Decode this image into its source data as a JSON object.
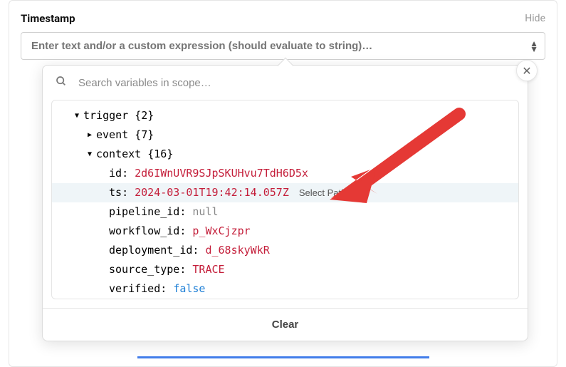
{
  "field": {
    "label": "Timestamp",
    "hide_label": "Hide",
    "placeholder": "Enter text and/or a custom expression (should evaluate to string)…"
  },
  "popup": {
    "search_placeholder": "Search variables in scope…",
    "clear_label": "Clear",
    "select_path_label": "Select Path"
  },
  "tree": {
    "root": {
      "name": "trigger",
      "count": "{2}"
    },
    "children": [
      {
        "name": "event",
        "count": "{7}",
        "expanded": false
      },
      {
        "name": "context",
        "count": "{16}",
        "expanded": true
      }
    ],
    "context_props": [
      {
        "key": "id",
        "value": "2d6IWnUVR9SJpSKUHvu7TdH6D5x",
        "type": "string",
        "highlighted": false
      },
      {
        "key": "ts",
        "value": "2024-03-01T19:42:14.057Z",
        "type": "string",
        "highlighted": true
      },
      {
        "key": "pipeline_id",
        "value": "null",
        "type": "null",
        "highlighted": false
      },
      {
        "key": "workflow_id",
        "value": "p_WxCjzpr",
        "type": "string",
        "highlighted": false
      },
      {
        "key": "deployment_id",
        "value": "d_68skyWkR",
        "type": "string",
        "highlighted": false
      },
      {
        "key": "source_type",
        "value": "TRACE",
        "type": "string",
        "highlighted": false
      },
      {
        "key": "verified",
        "value": "false",
        "type": "bool",
        "highlighted": false
      }
    ]
  }
}
